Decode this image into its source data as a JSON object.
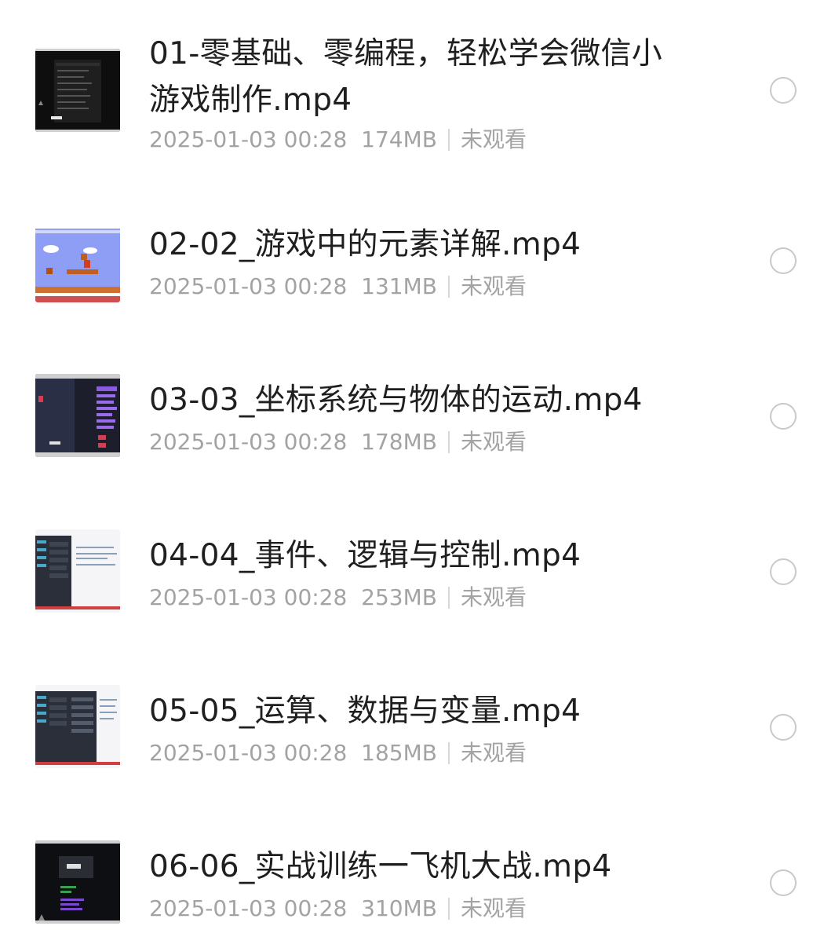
{
  "files": [
    {
      "title": "01-零基础、零编程，轻松学会微信小游戏制作.mp4",
      "date": "2025-01-03 00:28",
      "size": "174MB",
      "status": "未观看",
      "thumb": "dark-menu"
    },
    {
      "title": "02-02_游戏中的元素详解.mp4",
      "date": "2025-01-03 00:28",
      "size": "131MB",
      "status": "未观看",
      "thumb": "mario"
    },
    {
      "title": "03-03_坐标系统与物体的运动.mp4",
      "date": "2025-01-03 00:28",
      "size": "178MB",
      "status": "未观看",
      "thumb": "blocks-editor"
    },
    {
      "title": "04-04_事件、逻辑与控制.mp4",
      "date": "2025-01-03 00:28",
      "size": "253MB",
      "status": "未观看",
      "thumb": "blocks-doc"
    },
    {
      "title": "05-05_运算、数据与变量.mp4",
      "date": "2025-01-03 00:28",
      "size": "185MB",
      "status": "未观看",
      "thumb": "blocks-doc-2"
    },
    {
      "title": "06-06_实战训练一飞机大战.mp4",
      "date": "2025-01-03 00:28",
      "size": "310MB",
      "status": "未观看",
      "thumb": "dark-editor"
    }
  ],
  "colors": {
    "title": "#1f1f1f",
    "meta": "#a3a3a3",
    "radio_border": "#c9c9c9"
  }
}
